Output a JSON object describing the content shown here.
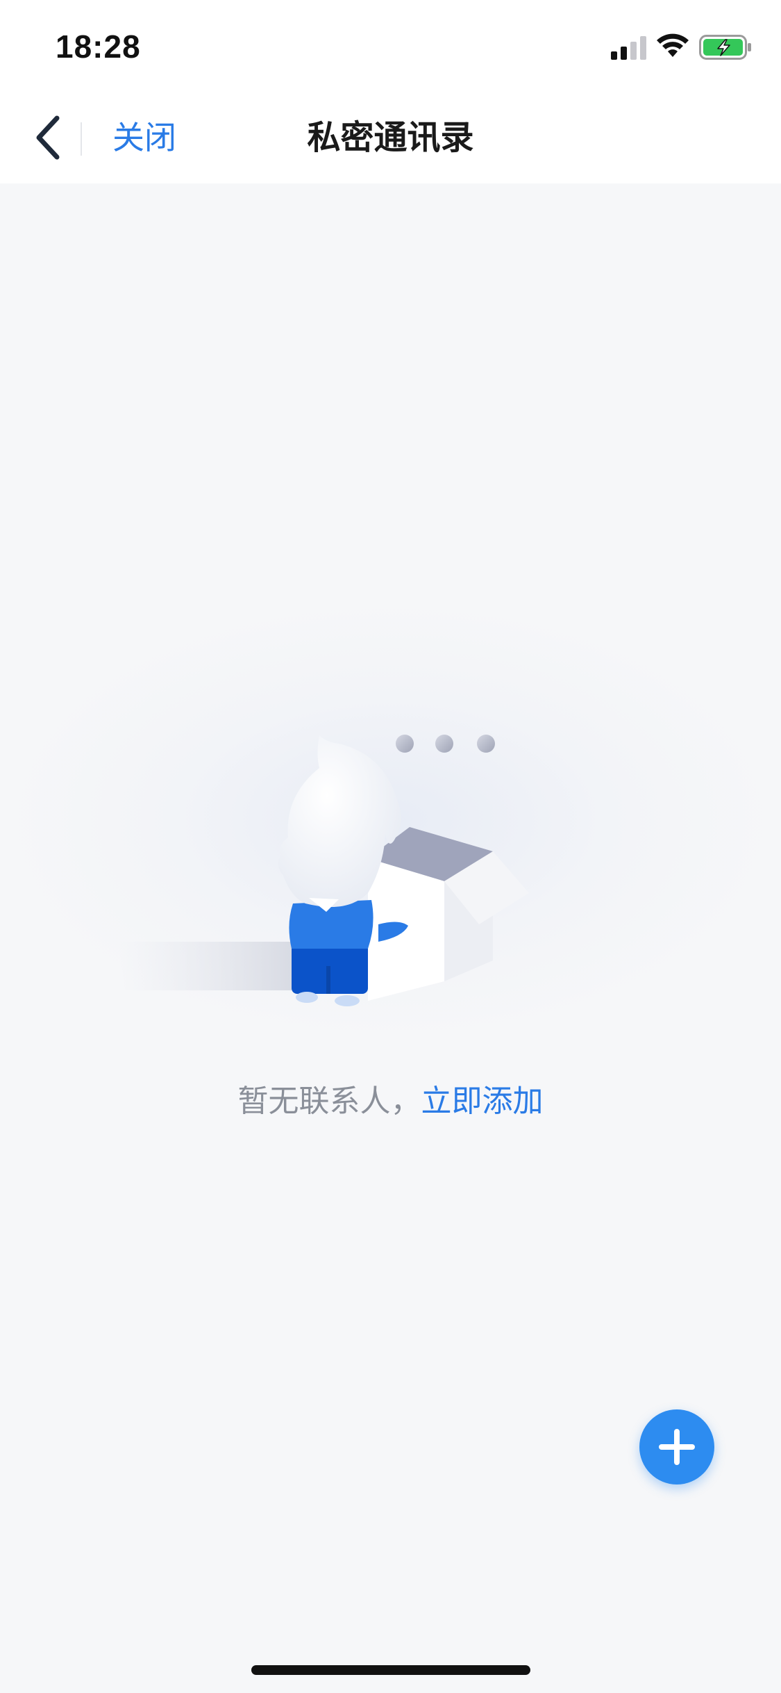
{
  "status_bar": {
    "time": "18:28",
    "icons": [
      "signal-icon",
      "wifi-icon",
      "battery-charging-icon"
    ],
    "battery_color": "#34c759"
  },
  "nav": {
    "back_icon": "chevron-left-icon",
    "close_label": "关闭",
    "title": "私密通讯录"
  },
  "empty_state": {
    "illustration": "person-with-open-box",
    "message": "暂无联系人，",
    "add_link": "立即添加"
  },
  "fab": {
    "icon": "plus-icon",
    "color": "#2d8cf0"
  },
  "colors": {
    "accent": "#2a7be6",
    "background": "#f6f7f9",
    "muted_text": "#8a8f99"
  }
}
